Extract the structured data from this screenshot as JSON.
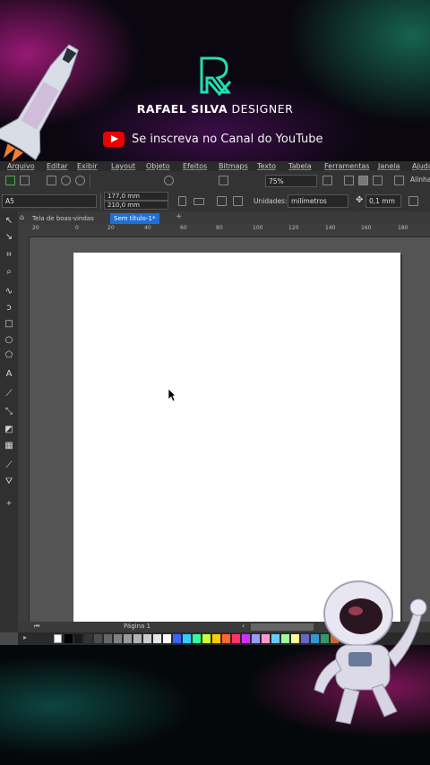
{
  "brand": {
    "name_bold": "RAFAEL SILVA",
    "name_light": "DESIGNER",
    "accent": "#1fe0b4"
  },
  "youtube": {
    "cta": "Se inscreva no Canal do YouTube",
    "icon": "youtube-play-icon",
    "color": "#ee1111"
  },
  "menu": [
    "Arquivo",
    "Editar",
    "Exibir",
    "Layout",
    "Objeto",
    "Efeitos",
    "Bitmaps",
    "Texto",
    "Tabela",
    "Ferramentas",
    "Janela",
    "Ajuda"
  ],
  "toolbar": {
    "zoom": "75%",
    "align_label": "Alinha"
  },
  "property_bar": {
    "page_size": "A5",
    "width": "177,0 mm",
    "height": "210,0 mm",
    "units_label": "Unidades:",
    "units_value": "milímetros",
    "nudge": "0,1 mm"
  },
  "tabs": [
    {
      "label": "Tela de boas-vindas",
      "active": false
    },
    {
      "label": "Sem título-1*",
      "active": true
    }
  ],
  "ruler_ticks": [
    "20",
    "0",
    "20",
    "40",
    "60",
    "80",
    "100",
    "120",
    "140",
    "160",
    "180"
  ],
  "status": {
    "page_tab": "Página 1"
  },
  "palette_colors": [
    "#000000",
    "#1a1a1a",
    "#333333",
    "#4d4d4d",
    "#666666",
    "#808080",
    "#999999",
    "#b3b3b3",
    "#cccccc",
    "#e6e6e6",
    "#ffffff",
    "#3366ff",
    "#33ccff",
    "#33ff99",
    "#ccff33",
    "#ffcc00",
    "#ff6633",
    "#ff3366",
    "#cc33ff",
    "#9999ff",
    "#ff99cc",
    "#66ccff",
    "#99ff99",
    "#ffff99",
    "#6666cc",
    "#3399cc",
    "#339966",
    "#cc6633"
  ],
  "colors": {
    "active_tab": "#1f6fd6",
    "app_bg": "#4a4a4a",
    "page": "#ffffff"
  }
}
